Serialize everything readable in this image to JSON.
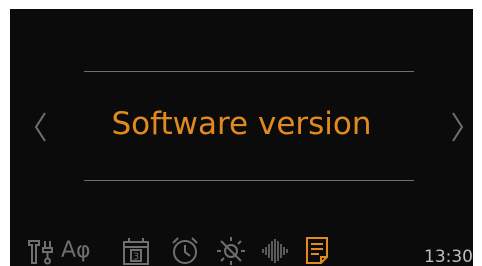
{
  "menu": {
    "title": "Software version",
    "prev_icon": "chevron-left-icon",
    "next_icon": "chevron-right-icon"
  },
  "toolbar": {
    "items": [
      {
        "name": "tools-icon"
      },
      {
        "name": "language-icon",
        "label": "Αφ"
      },
      {
        "name": "calendar-icon",
        "label": "3"
      },
      {
        "name": "alarm-clock-icon"
      },
      {
        "name": "brightness-icon"
      },
      {
        "name": "volume-icon"
      },
      {
        "name": "document-icon",
        "active": true
      }
    ]
  },
  "status": {
    "time": "13:30"
  },
  "colors": {
    "accent": "#e38a1f",
    "icon": "#6f6f6f",
    "background": "#0b0b0b",
    "divider": "#6d6d6d"
  }
}
